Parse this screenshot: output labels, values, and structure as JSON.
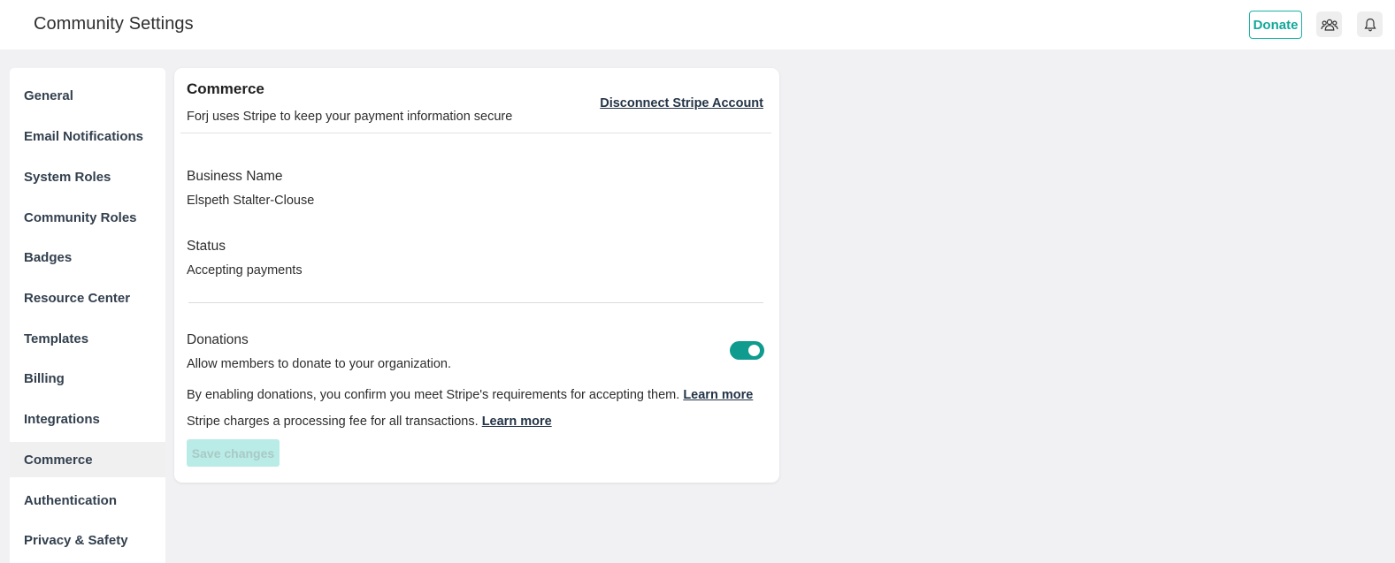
{
  "header": {
    "title": "Community Settings",
    "donate_label": "Donate",
    "community_icon": "community-icon",
    "bell_icon": "bell-icon"
  },
  "sidebar": {
    "items": [
      {
        "label": "General"
      },
      {
        "label": "Email Notifications"
      },
      {
        "label": "System Roles"
      },
      {
        "label": "Community Roles"
      },
      {
        "label": "Badges"
      },
      {
        "label": "Resource Center"
      },
      {
        "label": "Templates"
      },
      {
        "label": "Billing"
      },
      {
        "label": "Integrations"
      },
      {
        "label": "Commerce",
        "active": true
      },
      {
        "label": "Authentication"
      },
      {
        "label": "Privacy & Safety"
      }
    ]
  },
  "commerce": {
    "title": "Commerce",
    "subtitle": "Forj uses Stripe to keep your payment information secure",
    "disconnect_label": "Disconnect Stripe Account",
    "business_name_label": "Business Name",
    "business_name_value": "Elspeth Stalter-Clouse",
    "status_label": "Status",
    "status_value": "Accepting payments",
    "donations_label": "Donations",
    "donations_desc": "Allow members to donate to your organization.",
    "donations_enabled": true,
    "requirements_text": "By enabling donations, you confirm you meet Stripe's requirements for accepting them.",
    "fee_text": "Stripe charges a processing fee for all transactions.",
    "learn_more": "Learn more",
    "save_label": "Save changes"
  },
  "colors": {
    "accent": "#0f9b8e",
    "donate_border": "#1bb3a6",
    "save_disabled_bg": "#b9ece6"
  }
}
